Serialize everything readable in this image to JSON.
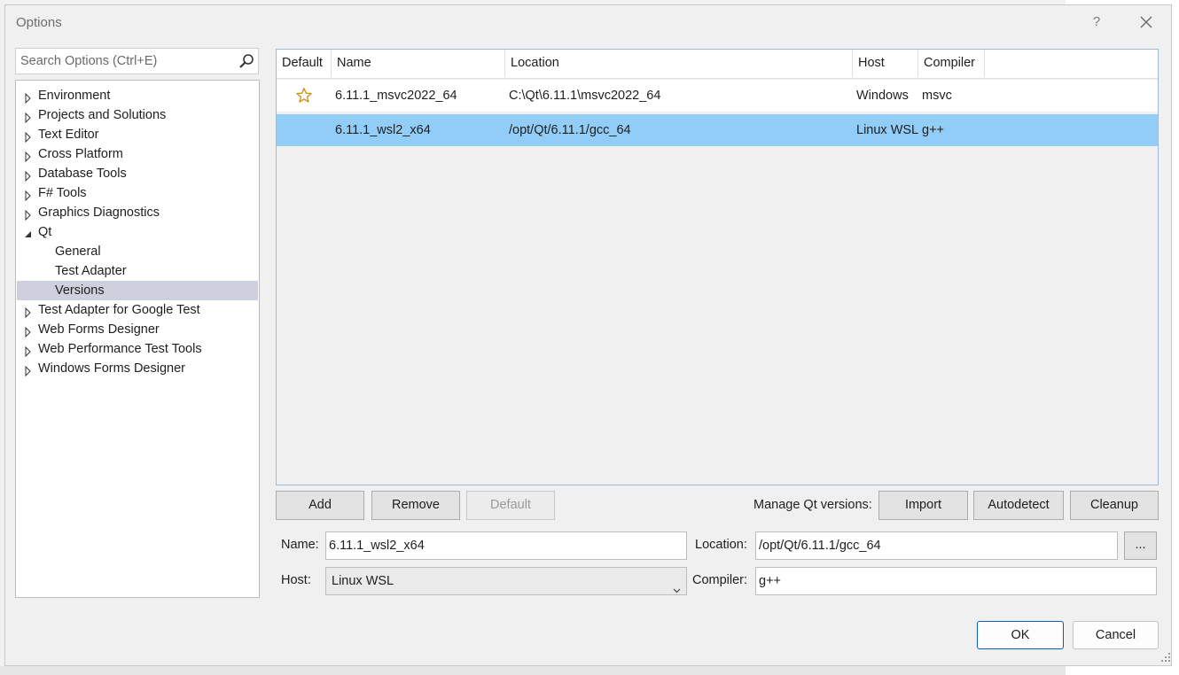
{
  "window": {
    "title": "Options",
    "help_label": "?"
  },
  "search": {
    "placeholder": "Search Options (Ctrl+E)"
  },
  "tree": {
    "items": [
      {
        "label": "Environment"
      },
      {
        "label": "Projects and Solutions"
      },
      {
        "label": "Text Editor"
      },
      {
        "label": "Cross Platform"
      },
      {
        "label": "Database Tools"
      },
      {
        "label": "F# Tools"
      },
      {
        "label": "Graphics Diagnostics"
      },
      {
        "label": "Qt"
      },
      {
        "label": "General"
      },
      {
        "label": "Test Adapter"
      },
      {
        "label": "Versions"
      },
      {
        "label": "Test Adapter for Google Test"
      },
      {
        "label": "Web Forms Designer"
      },
      {
        "label": "Web Performance Test Tools"
      },
      {
        "label": "Windows Forms Designer"
      }
    ],
    "selected": "Versions",
    "expanded": "Qt"
  },
  "versions_table": {
    "columns": [
      "Default",
      "Name",
      "Location",
      "Host",
      "Compiler"
    ],
    "rows": [
      {
        "default_icon": "star-outline-icon",
        "name": "6.11.1_msvc2022_64",
        "location": "C:\\Qt\\6.11.1\\msvc2022_64",
        "host": "Windows",
        "compiler": "msvc"
      },
      {
        "default_icon": "",
        "name": "6.11.1_wsl2_x64",
        "location": "/opt/Qt/6.11.1/gcc_64",
        "host": "Linux WSL",
        "compiler": "g++",
        "selected": true
      }
    ]
  },
  "actions": {
    "add": "Add",
    "remove": "Remove",
    "default": "Default",
    "manage_label": "Manage Qt versions:",
    "import": "Import",
    "autodetect": "Autodetect",
    "cleanup": "Cleanup"
  },
  "form": {
    "name_label": "Name:",
    "name_value": "6.11.1_wsl2_x64",
    "location_label": "Location:",
    "location_value": "/opt/Qt/6.11.1/gcc_64",
    "browse_label": "...",
    "host_label": "Host:",
    "host_value": "Linux WSL",
    "compiler_label": "Compiler:",
    "compiler_value": "g++"
  },
  "footer": {
    "ok": "OK",
    "cancel": "Cancel"
  },
  "colors": {
    "selection": "#91cdf6",
    "tree_selection": "#cfd0dd",
    "star": "#c8961e",
    "ok_border": "#0a5cb8"
  }
}
